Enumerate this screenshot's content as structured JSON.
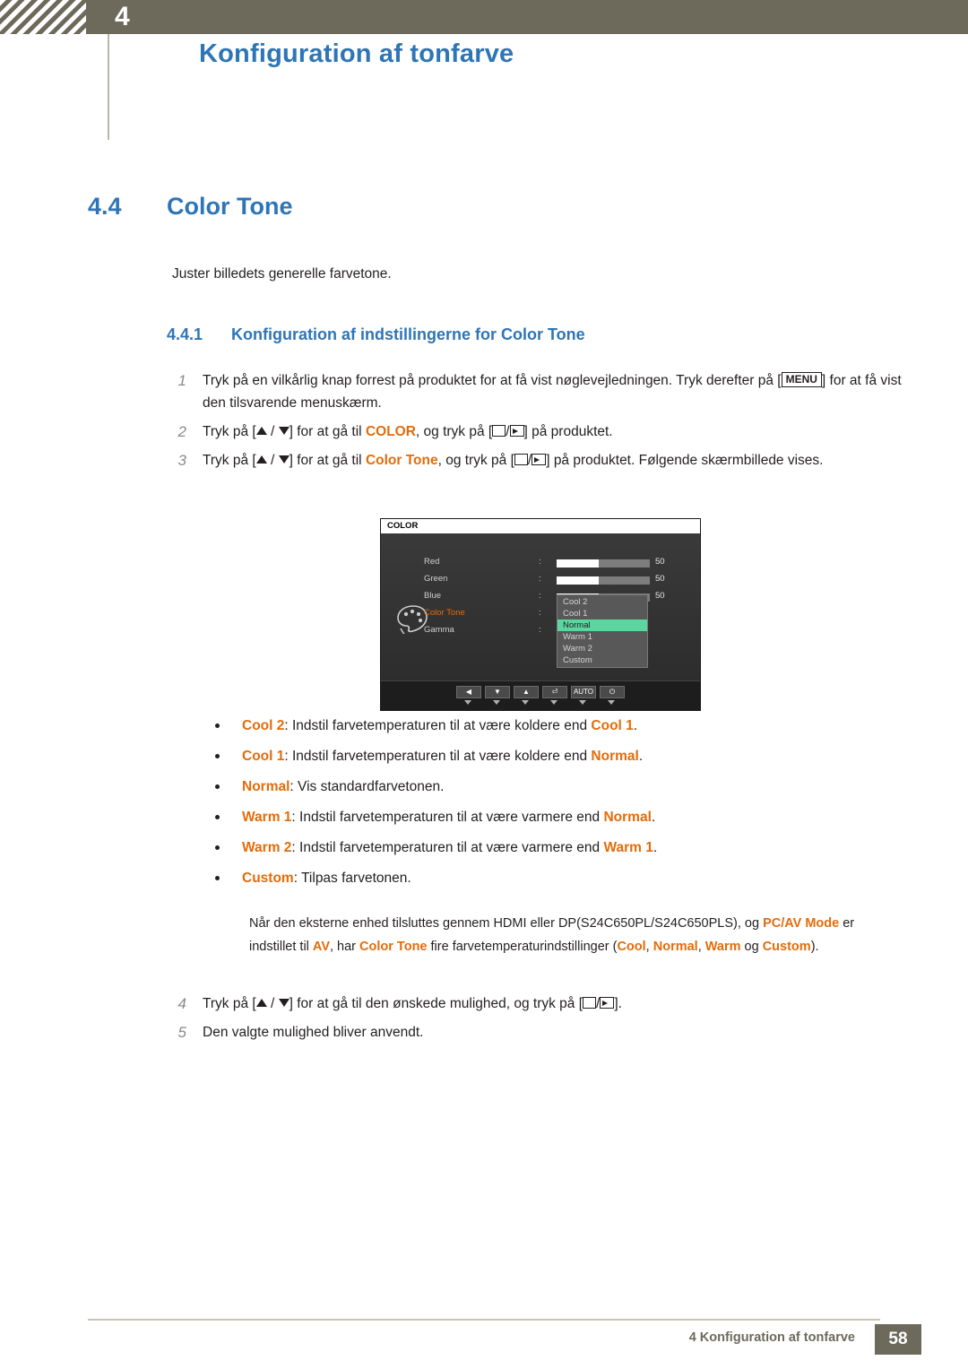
{
  "header": {
    "chapter_number": "4",
    "chapter_title": "Konfiguration af tonfarve"
  },
  "section": {
    "number": "4.4",
    "title": "Color Tone",
    "intro": "Juster billedets generelle farvetone.",
    "subsection_number": "4.4.1",
    "subsection_title": "Konfiguration af indstillingerne for Color Tone"
  },
  "steps": [
    {
      "n": "1",
      "parts": [
        {
          "t": "Tryk på en vilkårlig knap forrest på produktet for at få vist nøglevejledningen. Tryk derefter på [",
          "s": "plain"
        },
        {
          "t": "MENU",
          "s": "keycap"
        },
        {
          "t": "] for at få vist den tilsvarende menuskærm.",
          "s": "plain"
        }
      ]
    },
    {
      "n": "2",
      "parts": [
        {
          "t": "Tryk på [",
          "s": "plain"
        },
        {
          "t": "UPDOWN",
          "s": "arrows"
        },
        {
          "t": "] for at gå til ",
          "s": "plain"
        },
        {
          "t": "COLOR",
          "s": "orange"
        },
        {
          "t": ", og tryk på [",
          "s": "plain"
        },
        {
          "t": "ENTER",
          "s": "enter"
        },
        {
          "t": "] på produktet.",
          "s": "plain"
        }
      ]
    },
    {
      "n": "3",
      "parts": [
        {
          "t": "Tryk på [",
          "s": "plain"
        },
        {
          "t": "UPDOWN",
          "s": "arrows"
        },
        {
          "t": "] for at gå til ",
          "s": "plain"
        },
        {
          "t": "Color Tone",
          "s": "orange"
        },
        {
          "t": ", og tryk på [",
          "s": "plain"
        },
        {
          "t": "ENTER",
          "s": "enter"
        },
        {
          "t": "] på produktet. Følgende skærmbillede vises.",
          "s": "plain"
        }
      ]
    }
  ],
  "steps_after": [
    {
      "n": "4",
      "parts": [
        {
          "t": "Tryk på [",
          "s": "plain"
        },
        {
          "t": "UPDOWN",
          "s": "arrows"
        },
        {
          "t": "] for at gå til den ønskede mulighed, og tryk på [",
          "s": "plain"
        },
        {
          "t": "ENTER",
          "s": "enter"
        },
        {
          "t": "].",
          "s": "plain"
        }
      ]
    },
    {
      "n": "5",
      "parts": [
        {
          "t": "Den valgte mulighed bliver anvendt.",
          "s": "plain"
        }
      ]
    }
  ],
  "osd": {
    "title": "COLOR",
    "rows": [
      {
        "label": "Red",
        "colon": ":",
        "value": "50",
        "fill": 45,
        "highlight": false
      },
      {
        "label": "Green",
        "colon": ":",
        "value": "50",
        "fill": 45,
        "highlight": false
      },
      {
        "label": "Blue",
        "colon": ":",
        "value": "50",
        "fill": 45,
        "highlight": false
      },
      {
        "label": "Color Tone",
        "colon": ":",
        "value": "",
        "fill": 0,
        "highlight": true
      },
      {
        "label": "Gamma",
        "colon": ":",
        "value": "",
        "fill": 0,
        "highlight": false
      }
    ],
    "menu": [
      {
        "label": "Cool 2",
        "selected": false
      },
      {
        "label": "Cool 1",
        "selected": false
      },
      {
        "label": "Normal",
        "selected": true
      },
      {
        "label": "Warm 1",
        "selected": false
      },
      {
        "label": "Warm 2",
        "selected": false
      },
      {
        "label": "Custom",
        "selected": false
      }
    ],
    "footer_buttons": [
      "◀",
      "▼",
      "▲",
      "⏎",
      "AUTO",
      "⏻"
    ],
    "palette_icon": "palette-icon"
  },
  "bullets": [
    {
      "parts": [
        {
          "t": "Cool 2",
          "s": "orange"
        },
        {
          "t": ": Indstil farvetemperaturen til at være koldere end ",
          "s": "plain"
        },
        {
          "t": "Cool 1",
          "s": "orange"
        },
        {
          "t": ".",
          "s": "plain"
        }
      ]
    },
    {
      "parts": [
        {
          "t": "Cool 1",
          "s": "orange"
        },
        {
          "t": ": Indstil farvetemperaturen til at være koldere end ",
          "s": "plain"
        },
        {
          "t": "Normal",
          "s": "orange"
        },
        {
          "t": ".",
          "s": "plain"
        }
      ]
    },
    {
      "parts": [
        {
          "t": "Normal",
          "s": "orange"
        },
        {
          "t": ": Vis standardfarvetonen.",
          "s": "plain"
        }
      ]
    },
    {
      "parts": [
        {
          "t": "Warm 1",
          "s": "orange"
        },
        {
          "t": ": Indstil farvetemperaturen til at være varmere end ",
          "s": "plain"
        },
        {
          "t": "Normal",
          "s": "orange"
        },
        {
          "t": ".",
          "s": "plain"
        }
      ]
    },
    {
      "parts": [
        {
          "t": "Warm 2",
          "s": "orange"
        },
        {
          "t": ": Indstil farvetemperaturen til at være varmere end ",
          "s": "plain"
        },
        {
          "t": "Warm 1",
          "s": "orange"
        },
        {
          "t": ".",
          "s": "plain"
        }
      ]
    },
    {
      "parts": [
        {
          "t": "Custom",
          "s": "orange"
        },
        {
          "t": ": Tilpas farvetonen.",
          "s": "plain"
        }
      ]
    }
  ],
  "note": {
    "parts": [
      {
        "t": "Når den eksterne enhed tilsluttes gennem HDMI eller DP(S24C650PL/S24C650PLS), og ",
        "s": "plain"
      },
      {
        "t": "PC/AV Mode",
        "s": "orange"
      },
      {
        "t": " er indstillet til ",
        "s": "plain"
      },
      {
        "t": "AV",
        "s": "orange"
      },
      {
        "t": ", har ",
        "s": "plain"
      },
      {
        "t": "Color Tone",
        "s": "orange"
      },
      {
        "t": " fire farvetemperaturindstillinger (",
        "s": "plain"
      },
      {
        "t": "Cool",
        "s": "orange"
      },
      {
        "t": ", ",
        "s": "plain"
      },
      {
        "t": "Normal",
        "s": "orange"
      },
      {
        "t": ", ",
        "s": "plain"
      },
      {
        "t": "Warm",
        "s": "orange"
      },
      {
        "t": " og ",
        "s": "plain"
      },
      {
        "t": "Custom",
        "s": "orange"
      },
      {
        "t": ").",
        "s": "plain"
      }
    ]
  },
  "footer": {
    "text": "4 Konfiguration af tonfarve",
    "page": "58"
  },
  "colors": {
    "accent_blue": "#2e75b6",
    "accent_orange": "#e36c0a",
    "header_bar": "#6d6a5c",
    "osd_highlight": "#5bd6a0"
  }
}
